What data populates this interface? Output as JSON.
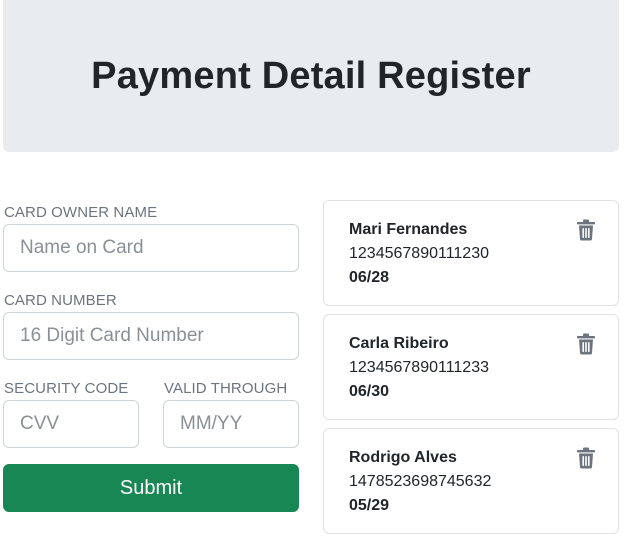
{
  "header": {
    "title": "Payment Detail Register"
  },
  "form": {
    "owner_label": "CARD OWNER NAME",
    "owner_placeholder": "Name on Card",
    "number_label": "CARD NUMBER",
    "number_placeholder": "16 Digit Card Number",
    "cvv_label": "SECURITY CODE",
    "cvv_placeholder": "CVV",
    "valid_label": "VALID THROUGH",
    "valid_placeholder": "MM/YY",
    "submit_label": "Submit"
  },
  "cards": [
    {
      "name": "Mari Fernandes",
      "number": "1234567890111230",
      "expiry": "06/28"
    },
    {
      "name": "Carla Ribeiro",
      "number": "1234567890111233",
      "expiry": "06/30"
    },
    {
      "name": "Rodrigo Alves",
      "number": "1478523698745632",
      "expiry": "05/29"
    }
  ],
  "icons": {
    "delete": "trash-icon"
  },
  "colors": {
    "header_bg": "#e9ecef",
    "submit": "#198754",
    "trash": "#6c757d"
  }
}
